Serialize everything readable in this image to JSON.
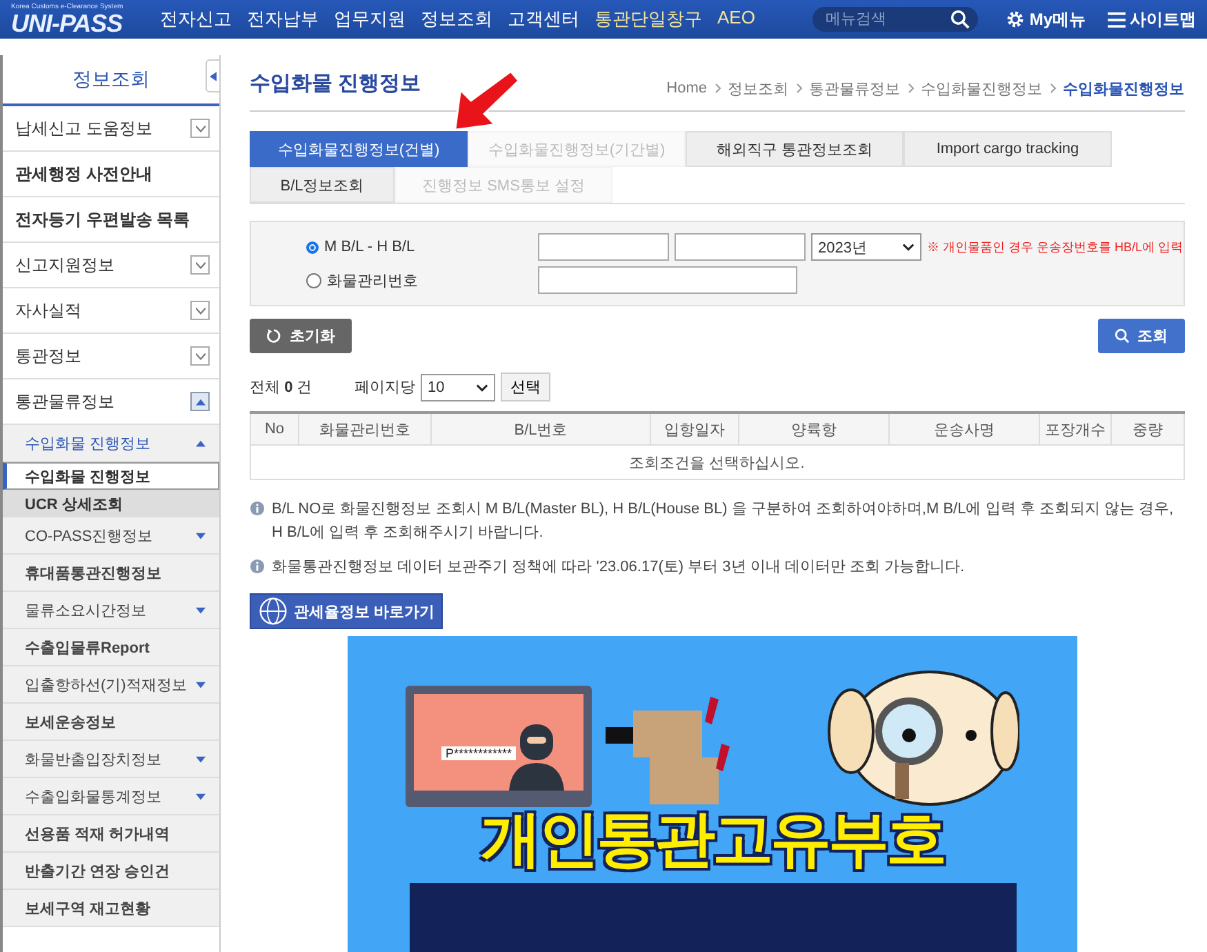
{
  "header": {
    "logo": "UNI-PASS",
    "logo_caption": "Korea Customs e-Clearance System",
    "nav": [
      {
        "label": "전자신고",
        "highlight": false
      },
      {
        "label": "전자납부",
        "highlight": false
      },
      {
        "label": "업무지원",
        "highlight": false
      },
      {
        "label": "정보조회",
        "highlight": false
      },
      {
        "label": "고객센터",
        "highlight": false
      },
      {
        "label": "통관단일창구",
        "highlight": true
      },
      {
        "label": "AEO",
        "highlight": true
      }
    ],
    "search": {
      "placeholder": "메뉴검색"
    },
    "my_menu": "My메뉴",
    "sitemap": "사이트맵"
  },
  "sidebar": {
    "title": "정보조회",
    "items": [
      {
        "label": "납세신고 도움정보",
        "kind": "group",
        "expanded": false
      },
      {
        "label": "관세행정 사전안내",
        "kind": "link"
      },
      {
        "label": "전자등기 우편발송 목록",
        "kind": "link"
      },
      {
        "label": "신고지원정보",
        "kind": "group",
        "expanded": false
      },
      {
        "label": "자사실적",
        "kind": "group",
        "expanded": false
      },
      {
        "label": "통관정보",
        "kind": "group",
        "expanded": false
      },
      {
        "label": "통관물류정보",
        "kind": "group",
        "expanded": true,
        "children": [
          {
            "label": "수입화물 진행정보",
            "kind": "group",
            "expanded": true,
            "children": [
              {
                "label": "수입화물 진행정보",
                "selected": true
              },
              {
                "label": "UCR 상세조회",
                "selected": false
              }
            ]
          },
          {
            "label": "CO-PASS진행정보",
            "kind": "group",
            "expanded": false
          },
          {
            "label": "휴대품통관진행정보",
            "kind": "link"
          },
          {
            "label": "물류소요시간정보",
            "kind": "group",
            "expanded": false
          },
          {
            "label": "수출입물류Report",
            "kind": "link"
          },
          {
            "label": "입출항하선(기)적재정보",
            "kind": "group",
            "expanded": false
          },
          {
            "label": "보세운송정보",
            "kind": "link"
          },
          {
            "label": "화물반출입장치정보",
            "kind": "group",
            "expanded": false
          },
          {
            "label": "수출입화물통계정보",
            "kind": "group",
            "expanded": false
          },
          {
            "label": "선용품 적재 허가내역",
            "kind": "link"
          },
          {
            "label": "반출기간 연장 승인건",
            "kind": "link"
          },
          {
            "label": "보세구역 재고현황",
            "kind": "link"
          }
        ]
      }
    ]
  },
  "page": {
    "title": "수입화물 진행정보",
    "breadcrumb": [
      "Home",
      "정보조회",
      "통관물류정보",
      "수입화물진행정보",
      "수입화물진행정보"
    ],
    "tabs": [
      {
        "label": "수입화물진행정보(건별)",
        "selected": true,
        "disabled": false
      },
      {
        "label": "수입화물진행정보(기간별)",
        "selected": false,
        "disabled": true
      },
      {
        "label": "해외직구 통관정보조회",
        "selected": false,
        "disabled": false
      },
      {
        "label": "Import cargo tracking",
        "selected": false,
        "disabled": false
      }
    ],
    "subtabs": [
      {
        "label": "B/L정보조회",
        "selected": false,
        "disabled": false
      },
      {
        "label": "진행정보 SMS통보 설정",
        "selected": false,
        "disabled": true
      }
    ],
    "form": {
      "options": [
        {
          "label": "M B/L - H B/L",
          "selected": true
        },
        {
          "label": "화물관리번호",
          "selected": false
        }
      ],
      "year": "2023년",
      "note": "※ 개인물품인 경우 운송장번호를 HB/L에 입력"
    },
    "reset_button": "초기화",
    "search_button": "조회",
    "total": "전체 **0** 건",
    "per_page_label": "페이지당",
    "per_page": "10",
    "select_button": "선택",
    "table": {
      "columns": [
        "No",
        "화물관리번호",
        "B/L번호",
        "입항일자",
        "양륙항",
        "운송사명",
        "포장개수",
        "중량"
      ],
      "empty": "조회조건을 선택하십시오."
    },
    "notes": [
      "B/L NO로 화물진행정보 조회시 M B/L(Master BL), H B/L(House BL) 을 구분하여 조회하여야하며,M B/L에 입력 후 조회되지 않는 경우, H B/L에 입력 후 조회해주시기 바랍니다.",
      "화물통관진행정보 데이터 보관주기 정책에 따라 '23.06.17(토) 부터 3년 이내 데이터만 조회 가능합니다."
    ],
    "tariff_link": "관세율정보 바로가기",
    "banner": {
      "masked_code": "P************",
      "headline": "개인통관고유부호"
    }
  }
}
